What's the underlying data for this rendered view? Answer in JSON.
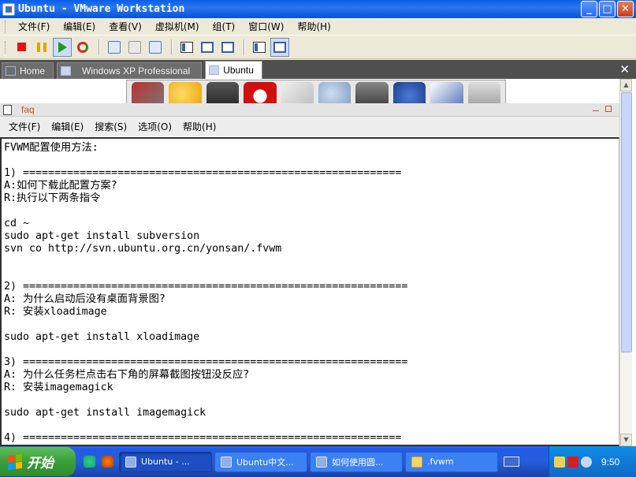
{
  "window": {
    "title": "Ubuntu - VMware Workstation",
    "controls": {
      "minimize": "_",
      "maximize": "□",
      "close": "✕"
    }
  },
  "menubar": [
    "文件(F)",
    "编辑(E)",
    "查看(V)",
    "虚拟机(M)",
    "组(T)",
    "窗口(W)",
    "帮助(H)"
  ],
  "tabs": [
    {
      "label": "Home",
      "active": false,
      "icon": "home-icon"
    },
    {
      "label": "Windows XP Professional",
      "active": false,
      "icon": "vm-icon"
    },
    {
      "label": "Ubuntu",
      "active": true,
      "icon": "vm-icon"
    }
  ],
  "tab_close": "✕",
  "gedit": {
    "title": "faq",
    "menu": [
      "文件(F)",
      "编辑(E)",
      "搜索(S)",
      "选项(O)",
      "帮助(H)"
    ]
  },
  "document": "FVWM配置使用方法:\n\n1) ============================================================\nA:如何下载此配置方案?\nR:执行以下两条指令\n\ncd ~\nsudo apt-get install subversion\nsvn co http://svn.ubuntu.org.cn/yonsan/.fvwm\n\n\n2) =============================================================\nA: 为什么启动后没有桌面背景图?\nR: 安装xloadimage\n\nsudo apt-get install xloadimage\n\n3) =============================================================\nA: 为什么任务栏点击右下角的屏幕截图按钮没反应?\nR: 安装imagemagick\n\nsudo apt-get install imagemagick\n\n4) ============================================================",
  "taskbar": {
    "start_label": "开始",
    "tasks": [
      {
        "label": "Ubuntu - ...",
        "active": true
      },
      {
        "label": "Ubuntu中文...",
        "active": false
      },
      {
        "label": "如何使用圆...",
        "active": false
      },
      {
        "label": ".fvwm",
        "active": false
      }
    ],
    "clock": "9:50"
  },
  "colors": {
    "xp_blue": "#0a5ee8",
    "start_green": "#3c9d3a",
    "gedit_title": "#c4562c"
  }
}
